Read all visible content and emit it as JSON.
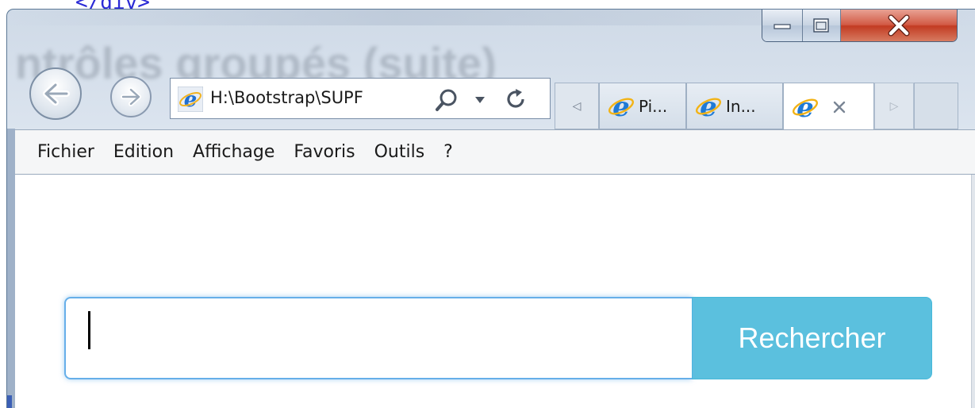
{
  "background": {
    "code_text": "</div>"
  },
  "window": {
    "frame_title_text": "ntrôles groupés (suite)",
    "caption_buttons": {
      "minimize_icon": "minimize-icon",
      "maximize_icon": "maximize-icon",
      "close_icon": "close-icon"
    }
  },
  "navigation": {
    "back_icon": "back-arrow-icon",
    "forward_icon": "forward-arrow-icon"
  },
  "address_bar": {
    "value": "H:\\Bootstrap\\SUPF",
    "favicon": "ie-icon",
    "search_icon": "search-icon",
    "dropdown_icon": "chevron-down-icon",
    "refresh_icon": "refresh-icon"
  },
  "tabs": [
    {
      "label": "Pi...",
      "active": false,
      "icon": "ie-icon"
    },
    {
      "label": "In...",
      "active": false,
      "icon": "ie-icon"
    },
    {
      "label": "",
      "active": true,
      "icon": "ie-icon",
      "close_icon": "close-icon"
    }
  ],
  "tab_scroll": {
    "left": "◁",
    "right": "▷"
  },
  "menu": [
    "Fichier",
    "Edition",
    "Affichage",
    "Favoris",
    "Outils",
    "?"
  ],
  "search": {
    "input_value": "",
    "button_label": "Rechercher",
    "focus_color": "#66afe9",
    "button_color": "#5bc0de"
  },
  "colors": {
    "close_button": "#c94a2f",
    "frame": "#dfe7f1"
  }
}
